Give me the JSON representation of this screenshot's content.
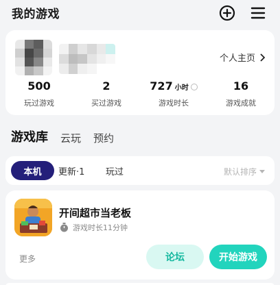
{
  "header": {
    "title": "我的游戏",
    "add_icon": "plus-circle-icon",
    "menu_icon": "hamburger-menu-icon"
  },
  "profile": {
    "link_label": "个人主页",
    "stats": [
      {
        "value": "500",
        "unit": "",
        "label": "玩过游戏"
      },
      {
        "value": "2",
        "unit": "",
        "label": "买过游戏"
      },
      {
        "value": "727",
        "unit": "小时",
        "label": "游戏时长"
      },
      {
        "value": "16",
        "unit": "",
        "label": "游戏成就"
      }
    ]
  },
  "tabs": [
    {
      "label": "游戏库",
      "active": true
    },
    {
      "label": "云玩",
      "active": false
    },
    {
      "label": "预约",
      "active": false
    }
  ],
  "filters": {
    "chips": [
      {
        "label": "本机",
        "active": true
      },
      {
        "label": "更新·1",
        "active": false
      },
      {
        "label": "玩过",
        "active": false
      }
    ],
    "sort_label": "默认排序"
  },
  "game": {
    "name": "开间超市当老板",
    "playtime": "游戏时长11分钟",
    "more_label": "更多",
    "forum_label": "论坛",
    "play_label": "开始游戏"
  },
  "colors": {
    "accent": "#22d4bd",
    "tab_underline": "#2cd6c2",
    "chip_active": "#241f7a",
    "forum_bg": "#d9f8f2"
  }
}
